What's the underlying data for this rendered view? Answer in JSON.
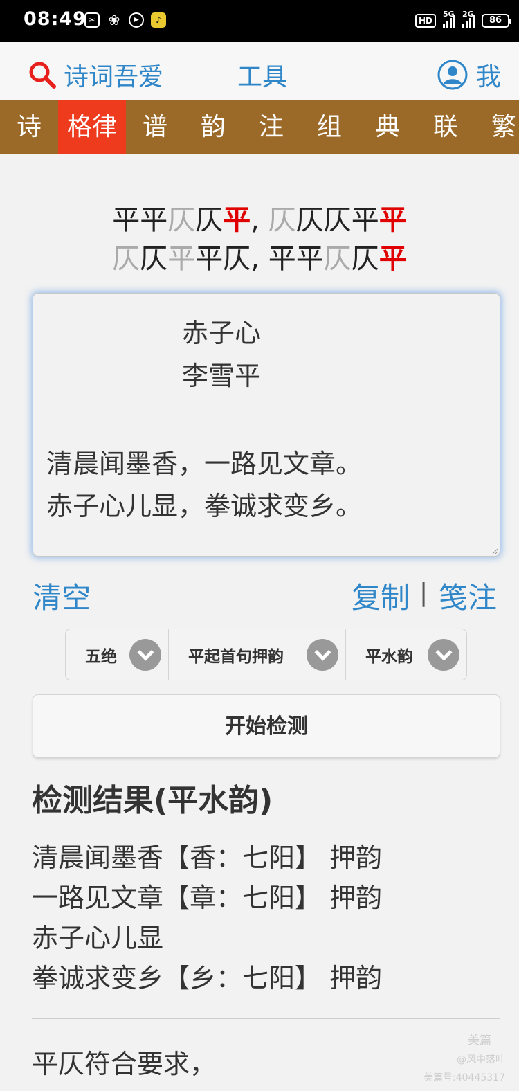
{
  "status_bar": {
    "time": "08:49",
    "hd_label": "HD",
    "signal_1": "5G",
    "signal_2": "2G",
    "battery": "86"
  },
  "header": {
    "brand": "诗词吾爱",
    "tools": "工具",
    "me": "我"
  },
  "nav": {
    "items": [
      "诗",
      "格律",
      "谱",
      "韵",
      "注",
      "组",
      "典",
      "联",
      "繁"
    ],
    "active_index": 1
  },
  "pattern": {
    "lines": [
      [
        {
          "t": "平平",
          "c": "b"
        },
        {
          "t": "仄",
          "c": "g"
        },
        {
          "t": "仄",
          "c": "b"
        },
        {
          "t": "平",
          "c": "r"
        },
        {
          "t": ", ",
          "c": "b"
        },
        {
          "t": "仄",
          "c": "g"
        },
        {
          "t": "仄仄平",
          "c": "b"
        },
        {
          "t": "平",
          "c": "r"
        }
      ],
      [
        {
          "t": "仄",
          "c": "g"
        },
        {
          "t": "仄",
          "c": "b"
        },
        {
          "t": "平",
          "c": "g"
        },
        {
          "t": "平仄, 平平",
          "c": "b"
        },
        {
          "t": "仄",
          "c": "g"
        },
        {
          "t": "仄",
          "c": "b"
        },
        {
          "t": "平",
          "c": "r"
        }
      ]
    ]
  },
  "poem": {
    "title": "赤子心",
    "author": "李雪平",
    "line1": "清晨闻墨香，一路见文章。",
    "line2": "赤子心儿显，拳诚求变乡。"
  },
  "actions": {
    "clear": "清空",
    "copy": "复制",
    "separator": "|",
    "annotate": "笺注"
  },
  "selectors": {
    "form": "五绝",
    "start_mode": "平起首句押韵",
    "rhyme_book": "平水韵"
  },
  "start_button": "开始检测",
  "result": {
    "title": "检测结果(平水韵)",
    "lines": [
      "清晨闻墨香【香：七阳】 押韵",
      "一路见文章【章：七阳】 押韵",
      "赤子心儿显",
      "拳诚求变乡【乡：七阳】 押韵"
    ],
    "conclusion": "平仄符合要求，"
  },
  "watermark": {
    "line1": "美篇",
    "line2": "@风中落叶",
    "line3": "美篇号:40445317"
  },
  "colors": {
    "accent_blue": "#2f86c8",
    "nav_brown": "#9c6a28",
    "nav_active": "#ee3a1d",
    "rhyme_red": "#e00000"
  }
}
